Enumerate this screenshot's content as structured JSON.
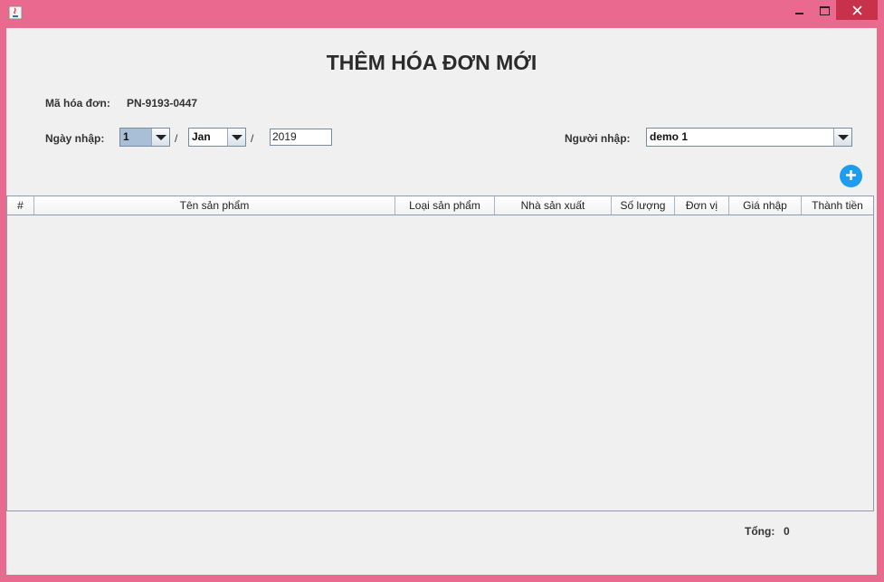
{
  "window": {
    "controls": {
      "minimize": "minimize-icon",
      "maximize": "maximize-icon",
      "close": "close-icon"
    }
  },
  "form": {
    "title": "THÊM HÓA ĐƠN MỚI",
    "invoice_code_label": "Mã hóa đơn:",
    "invoice_code": "PN-9193-0447",
    "date_label": "Ngày nhập:",
    "day": "1",
    "separator": "/",
    "month": "Jan",
    "year": "2019",
    "importer_label": "Người nhập:",
    "importer": "demo 1",
    "add_icon": "plus-icon"
  },
  "table": {
    "columns": [
      "#",
      "Tên sản phẩm",
      "Loại sản phẩm",
      "Nhà sản xuất",
      "Số lượng",
      "Đơn vị",
      "Giá nhập",
      "Thành tiền"
    ],
    "rows": []
  },
  "footer": {
    "total_label": "Tổng:",
    "total_value": "0"
  },
  "colors": {
    "frame": "#e9698f",
    "close_button": "#c7314a",
    "add_button": "#1e9cf0",
    "client_bg": "#f0f0f0"
  }
}
